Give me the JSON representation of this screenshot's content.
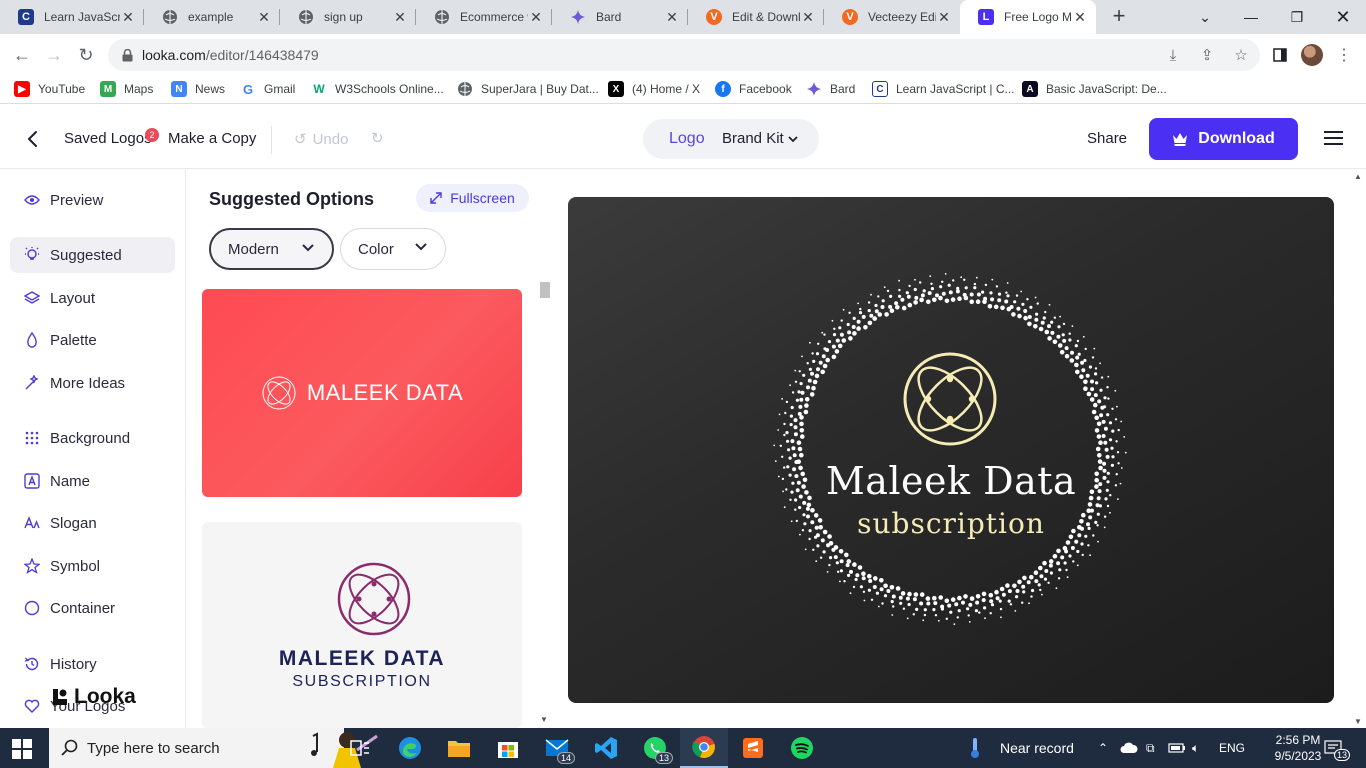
{
  "browser": {
    "tabs": [
      {
        "title": "Learn JavaScr",
        "icon": "codecademy-icon",
        "color": "#1f3a8a"
      },
      {
        "title": "example",
        "icon": "globe-icon",
        "color": "#5f6368"
      },
      {
        "title": "sign up",
        "icon": "globe-icon",
        "color": "#5f6368"
      },
      {
        "title": "Ecommerce w",
        "icon": "globe-icon",
        "color": "#5f6368"
      },
      {
        "title": "Bard",
        "icon": "bard-icon",
        "color": "#6b5bd6"
      },
      {
        "title": "Edit & Downl",
        "icon": "vecteezy-icon",
        "color": "#f26a21"
      },
      {
        "title": "Vecteezy Edit",
        "icon": "vecteezy-icon",
        "color": "#f26a21"
      },
      {
        "title": "Free Logo Ma",
        "icon": "looka-icon",
        "color": "#4b2ff2"
      }
    ],
    "url_host": "looka.com",
    "url_path": "/editor/146438479",
    "bookmarks": [
      {
        "label": "YouTube",
        "icon": "youtube-icon",
        "color": "#ff0000"
      },
      {
        "label": "Maps",
        "icon": "maps-icon",
        "color": "#34a853"
      },
      {
        "label": "News",
        "icon": "news-icon",
        "color": "#4285f4"
      },
      {
        "label": "Gmail",
        "icon": "google-icon",
        "color": "#4285f4"
      },
      {
        "label": "W3Schools Online...",
        "icon": "w3schools-icon",
        "color": "#04aa6d"
      },
      {
        "label": "SuperJara | Buy Dat...",
        "icon": "globe-icon",
        "color": "#5f6368"
      },
      {
        "label": "(4) Home / X",
        "icon": "x-icon",
        "color": "#000000"
      },
      {
        "label": "Facebook",
        "icon": "facebook-icon",
        "color": "#1877f2"
      },
      {
        "label": "Bard",
        "icon": "bard-icon",
        "color": "#6b5bd6"
      },
      {
        "label": "Learn JavaScript | C...",
        "icon": "codecademy-icon",
        "color": "#1f3a8a"
      },
      {
        "label": "Basic JavaScript: De...",
        "icon": "freecodecamp-icon",
        "color": "#0a0a23"
      }
    ]
  },
  "header": {
    "saved_logos": "Saved Logos",
    "saved_count": "2",
    "make_copy": "Make a Copy",
    "undo": "Undo",
    "tab_logo": "Logo",
    "tab_brand_kit": "Brand Kit",
    "share": "Share",
    "download": "Download",
    "accent": "#4b2ff2"
  },
  "sidebar": {
    "items": [
      {
        "label": "Preview",
        "icon": "eye-icon"
      },
      {
        "label": "Suggested",
        "icon": "lightbulb-icon",
        "active": true
      },
      {
        "label": "Layout",
        "icon": "layers-icon"
      },
      {
        "label": "Palette",
        "icon": "droplet-icon"
      },
      {
        "label": "More Ideas",
        "icon": "magic-wand-icon"
      },
      {
        "label": "Background",
        "icon": "dots-grid-icon"
      },
      {
        "label": "Name",
        "icon": "name-a-icon"
      },
      {
        "label": "Slogan",
        "icon": "slogan-aa-icon"
      },
      {
        "label": "Symbol",
        "icon": "star-icon"
      },
      {
        "label": "Container",
        "icon": "circle-icon"
      },
      {
        "label": "History",
        "icon": "history-icon"
      },
      {
        "label": "Your Logos",
        "icon": "heart-icon"
      }
    ],
    "brand": "Looka"
  },
  "suggested": {
    "title": "Suggested Options",
    "fullscreen": "Fullscreen",
    "style_filter": "Modern",
    "color_filter": "Color",
    "card1_text": "MALEEK DATA",
    "card1_color": "#ff4a52",
    "card2_name": "MALEEK DATA",
    "card2_slogan": "SUBSCRIPTION",
    "card2_color": "#1d2257",
    "card2_symbol_color": "#8a2b6b"
  },
  "preview": {
    "name": "Maleek Data",
    "slogan": "subscription",
    "symbol_color": "#f5ecb5",
    "background": "#2a2a2a"
  },
  "taskbar": {
    "search_placeholder": "Type here to search",
    "apps": [
      {
        "name": "task-view",
        "icon": "task-view-icon"
      },
      {
        "name": "edge",
        "icon": "edge-icon"
      },
      {
        "name": "file-explorer",
        "icon": "folder-icon"
      },
      {
        "name": "store",
        "icon": "store-icon"
      },
      {
        "name": "mail",
        "icon": "mail-icon",
        "count": "14"
      },
      {
        "name": "vscode",
        "icon": "vscode-icon"
      },
      {
        "name": "whatsapp",
        "icon": "whatsapp-icon",
        "count": "13"
      },
      {
        "name": "chrome",
        "icon": "chrome-icon",
        "active": true
      },
      {
        "name": "sublime",
        "icon": "sublime-icon"
      },
      {
        "name": "spotify",
        "icon": "spotify-icon"
      }
    ],
    "weather": "Near record",
    "lang": "ENG",
    "time": "2:56 PM",
    "date": "9/5/2023",
    "notifications": "13"
  }
}
